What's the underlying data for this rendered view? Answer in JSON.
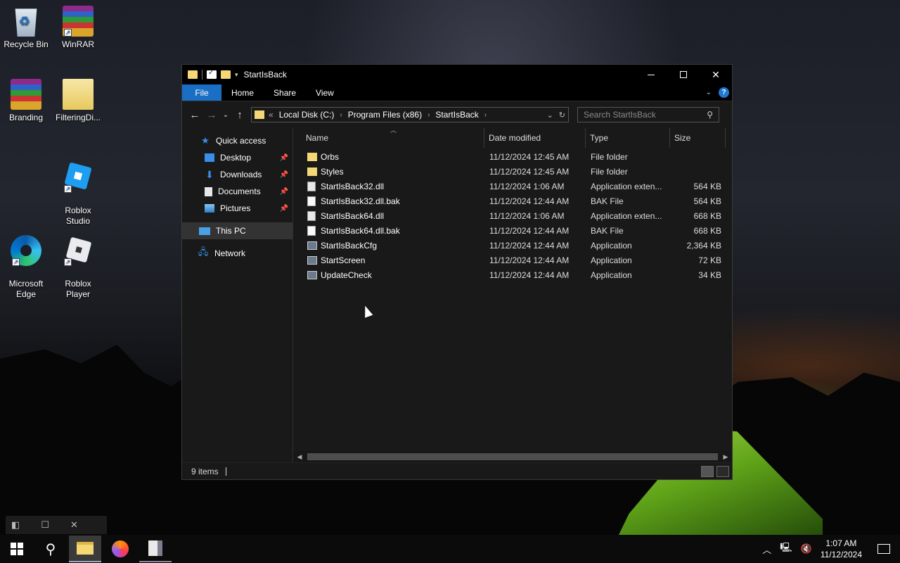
{
  "desktop": {
    "icons": [
      {
        "label": "Recycle Bin",
        "icon": "recycle-bin-icon"
      },
      {
        "label": "WinRAR",
        "icon": "winrar-icon"
      },
      {
        "label": "Branding",
        "icon": "winrar-archive-icon"
      },
      {
        "label": "FilteringDi...",
        "icon": "folder-file-icon"
      },
      {
        "label": "Roblox\nStudio",
        "icon": "roblox-studio-icon"
      },
      {
        "label": "Microsoft\nEdge",
        "icon": "edge-icon"
      },
      {
        "label": "Roblox\nPlayer",
        "icon": "roblox-player-icon"
      }
    ]
  },
  "window": {
    "title": "StartIsBack",
    "ribbon_tabs": [
      "File",
      "Home",
      "Share",
      "View"
    ],
    "help_label": "?",
    "address": {
      "prefix": "«",
      "crumbs": [
        "Local Disk (C:)",
        "Program Files (x86)",
        "StartIsBack"
      ]
    },
    "search_placeholder": "Search StartIsBack",
    "nav": {
      "quick_access": "Quick access",
      "items": [
        "Desktop",
        "Downloads",
        "Documents",
        "Pictures"
      ],
      "this_pc": "This PC",
      "network": "Network"
    },
    "columns": {
      "name": "Name",
      "date": "Date modified",
      "type": "Type",
      "size": "Size"
    },
    "files": [
      {
        "name": "Orbs",
        "date": "11/12/2024 12:45 AM",
        "type": "File folder",
        "size": "",
        "kind": "folder"
      },
      {
        "name": "Styles",
        "date": "11/12/2024 12:45 AM",
        "type": "File folder",
        "size": "",
        "kind": "folder"
      },
      {
        "name": "StartIsBack32.dll",
        "date": "11/12/2024 1:06 AM",
        "type": "Application exten...",
        "size": "564 KB",
        "kind": "dll"
      },
      {
        "name": "StartIsBack32.dll.bak",
        "date": "11/12/2024 12:44 AM",
        "type": "BAK File",
        "size": "564 KB",
        "kind": "bak"
      },
      {
        "name": "StartIsBack64.dll",
        "date": "11/12/2024 1:06 AM",
        "type": "Application exten...",
        "size": "668 KB",
        "kind": "dll"
      },
      {
        "name": "StartIsBack64.dll.bak",
        "date": "11/12/2024 12:44 AM",
        "type": "BAK File",
        "size": "668 KB",
        "kind": "bak"
      },
      {
        "name": "StartIsBackCfg",
        "date": "11/12/2024 12:44 AM",
        "type": "Application",
        "size": "2,364 KB",
        "kind": "app"
      },
      {
        "name": "StartScreen",
        "date": "11/12/2024 12:44 AM",
        "type": "Application",
        "size": "72 KB",
        "kind": "app"
      },
      {
        "name": "UpdateCheck",
        "date": "11/12/2024 12:44 AM",
        "type": "Application",
        "size": "34 KB",
        "kind": "app"
      }
    ],
    "status": "9 items"
  },
  "taskbar": {
    "time": "1:07 AM",
    "date": "11/12/2024"
  },
  "colors": {
    "accent": "#1a6fc4",
    "folder": "#f5d775",
    "background": "#191919"
  }
}
